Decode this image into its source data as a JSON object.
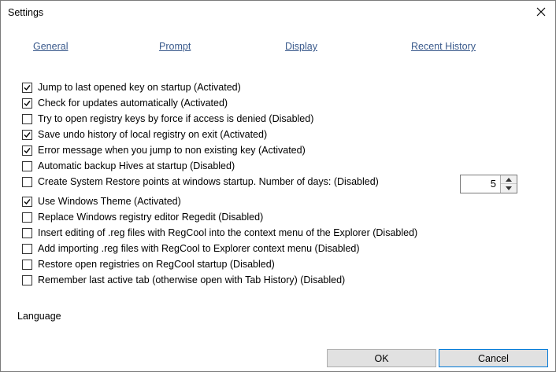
{
  "window": {
    "title": "Settings"
  },
  "tabs": [
    "General",
    "Prompt",
    "Display",
    "Recent History"
  ],
  "options": [
    {
      "label": "Jump to last opened key on startup (Activated)",
      "checked": true
    },
    {
      "label": "Check for updates automatically (Activated)",
      "checked": true
    },
    {
      "label": "Try to open registry keys by force if access is denied (Disabled)",
      "checked": false
    },
    {
      "label": "Save undo history of local registry on exit (Activated)",
      "checked": true
    },
    {
      "label": "Error message when you jump to non existing key (Activated)",
      "checked": true
    },
    {
      "label": "Automatic backup Hives at startup (Disabled)",
      "checked": false
    },
    {
      "label": "Create System Restore points at windows startup. Number of days: (Disabled)",
      "checked": false
    },
    {
      "label": "Use Windows Theme (Activated)",
      "checked": true
    },
    {
      "label": "Replace Windows registry editor Regedit (Disabled)",
      "checked": false
    },
    {
      "label": "Insert editing of .reg files with RegCool into the context menu of the Explorer (Disabled)",
      "checked": false
    },
    {
      "label": "Add importing .reg files with RegCool to Explorer context menu  (Disabled)",
      "checked": false
    },
    {
      "label": "Restore open registries on RegCool startup (Disabled)",
      "checked": false
    },
    {
      "label": "Remember last active tab (otherwise open with Tab History) (Disabled)",
      "checked": false
    }
  ],
  "restore_days": "5",
  "language_label": "Language",
  "buttons": {
    "ok": "OK",
    "cancel": "Cancel"
  }
}
